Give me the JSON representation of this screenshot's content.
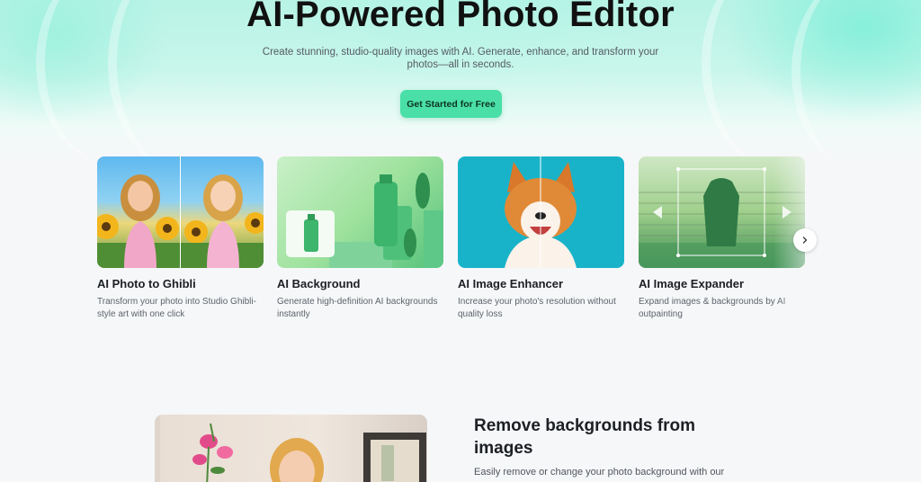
{
  "hero": {
    "title": "AI-Powered Photo Editor",
    "subtitle": "Create stunning, studio-quality images with AI. Generate, enhance, and transform your photos—all in seconds.",
    "cta_label": "Get Started for Free"
  },
  "colors": {
    "accent": "#49dfa7",
    "hero_bg": "#c9f6eb",
    "page_bg": "#f6f7f9"
  },
  "features": [
    {
      "title": "AI Photo to Ghibli",
      "description": "Transform your photo into Studio Ghibli-style art with one click",
      "image": "ghibli-girl-sunflowers"
    },
    {
      "title": "AI Background",
      "description": "Generate high-definition AI backgrounds instantly",
      "image": "green-product-bottles"
    },
    {
      "title": "AI Image Enhancer",
      "description": "Increase your photo's resolution without quality loss",
      "image": "corgi-dog"
    },
    {
      "title": "AI Image Expander",
      "description": "Expand images & backgrounds by AI outpainting",
      "image": "green-jacket-on-fence"
    }
  ],
  "carousel": {
    "next_icon": "chevron-right-icon"
  },
  "remove_bg": {
    "title": "Remove backgrounds from images",
    "description": "Easily remove or change your photo background with our"
  }
}
